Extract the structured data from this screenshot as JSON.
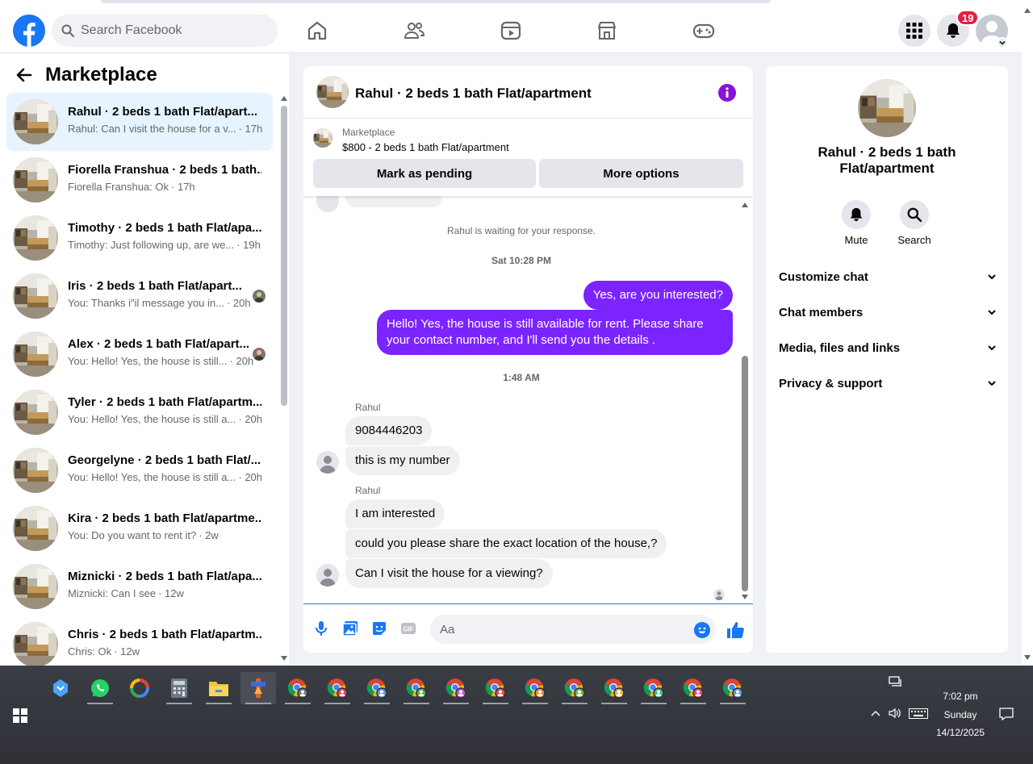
{
  "header": {
    "search_placeholder": "Search Facebook",
    "notifications_count": "19"
  },
  "sidebar": {
    "title": "Marketplace",
    "conversations": [
      {
        "title": "Rahul · 2 beds 1 bath Flat/apart...",
        "snippet": "Rahul: Can I visit the house for a v...",
        "time": "· 17h",
        "active": true
      },
      {
        "title": "Fiorella Franshua · 2 beds 1 bath...",
        "snippet": "Fiorella Franshua: Ok",
        "time": "· 17h"
      },
      {
        "title": "Timothy · 2 beds 1 bath Flat/apa...",
        "snippet": "Timothy: Just following up, are we...",
        "time": "· 19h"
      },
      {
        "title": "Iris · 2 beds 1 bath Flat/apart...",
        "snippet": "You: Thanks i\"il message you in...",
        "time": "· 20h"
      },
      {
        "title": "Alex · 2 beds 1 bath Flat/apart...",
        "snippet": "You: Hello! Yes, the house is still...",
        "time": "· 20h"
      },
      {
        "title": "Tyler · 2 beds 1 bath Flat/apartm...",
        "snippet": "You: Hello! Yes, the house is still a...",
        "time": "· 20h"
      },
      {
        "title": "Georgelyne · 2 beds 1 bath Flat/...",
        "snippet": "You: Hello! Yes, the house is still a...",
        "time": "· 20h"
      },
      {
        "title": "Kira · 2 beds 1 bath Flat/apartme...",
        "snippet": "You: Do you want to rent it?",
        "time": "· 2w"
      },
      {
        "title": "Miznicki · 2 beds 1 bath Flat/apa...",
        "snippet": "Miznicki: Can I see",
        "time": "· 12w"
      },
      {
        "title": "Chris · 2 beds 1 bath Flat/apartm...",
        "snippet": "Chris: Ok",
        "time": "· 12w"
      }
    ]
  },
  "chat": {
    "title": "Rahul · 2 beds 1 bath Flat/apartment",
    "marketplace_label": "Marketplace",
    "listing": "$800 - 2 beds 1 bath Flat/apartment",
    "mark_pending": "Mark as pending",
    "more_options": "More options",
    "waiting_text": "Rahul is waiting for your response.",
    "time1": "Sat 10:28 PM",
    "out1": "Yes, are you interested?",
    "out2": "Hello! Yes, the house is still available for rent. Please share your contact number, and I'll send you the details .",
    "time2": "1:48 AM",
    "sender": "Rahul",
    "in1": "9084446203",
    "in2": "this is my number",
    "in3": "I am interested",
    "in4": "could you please share the exact location of the house,?",
    "in5": "Can I visit the house for a viewing?",
    "composer_placeholder": "Aa"
  },
  "rpanel": {
    "name": "Rahul · 2 beds 1 bath Flat/apartment",
    "mute": "Mute",
    "search": "Search",
    "rows": [
      "Customize chat",
      "Chat members",
      "Media, files and links",
      "Privacy & support"
    ]
  },
  "taskbar": {
    "time": "7:02 pm",
    "day": "Sunday",
    "date": "14/12/2025"
  },
  "colors": {
    "accent": "#1877f2",
    "bubble_out": "#7b24ff",
    "badge": "#e41e3f"
  }
}
